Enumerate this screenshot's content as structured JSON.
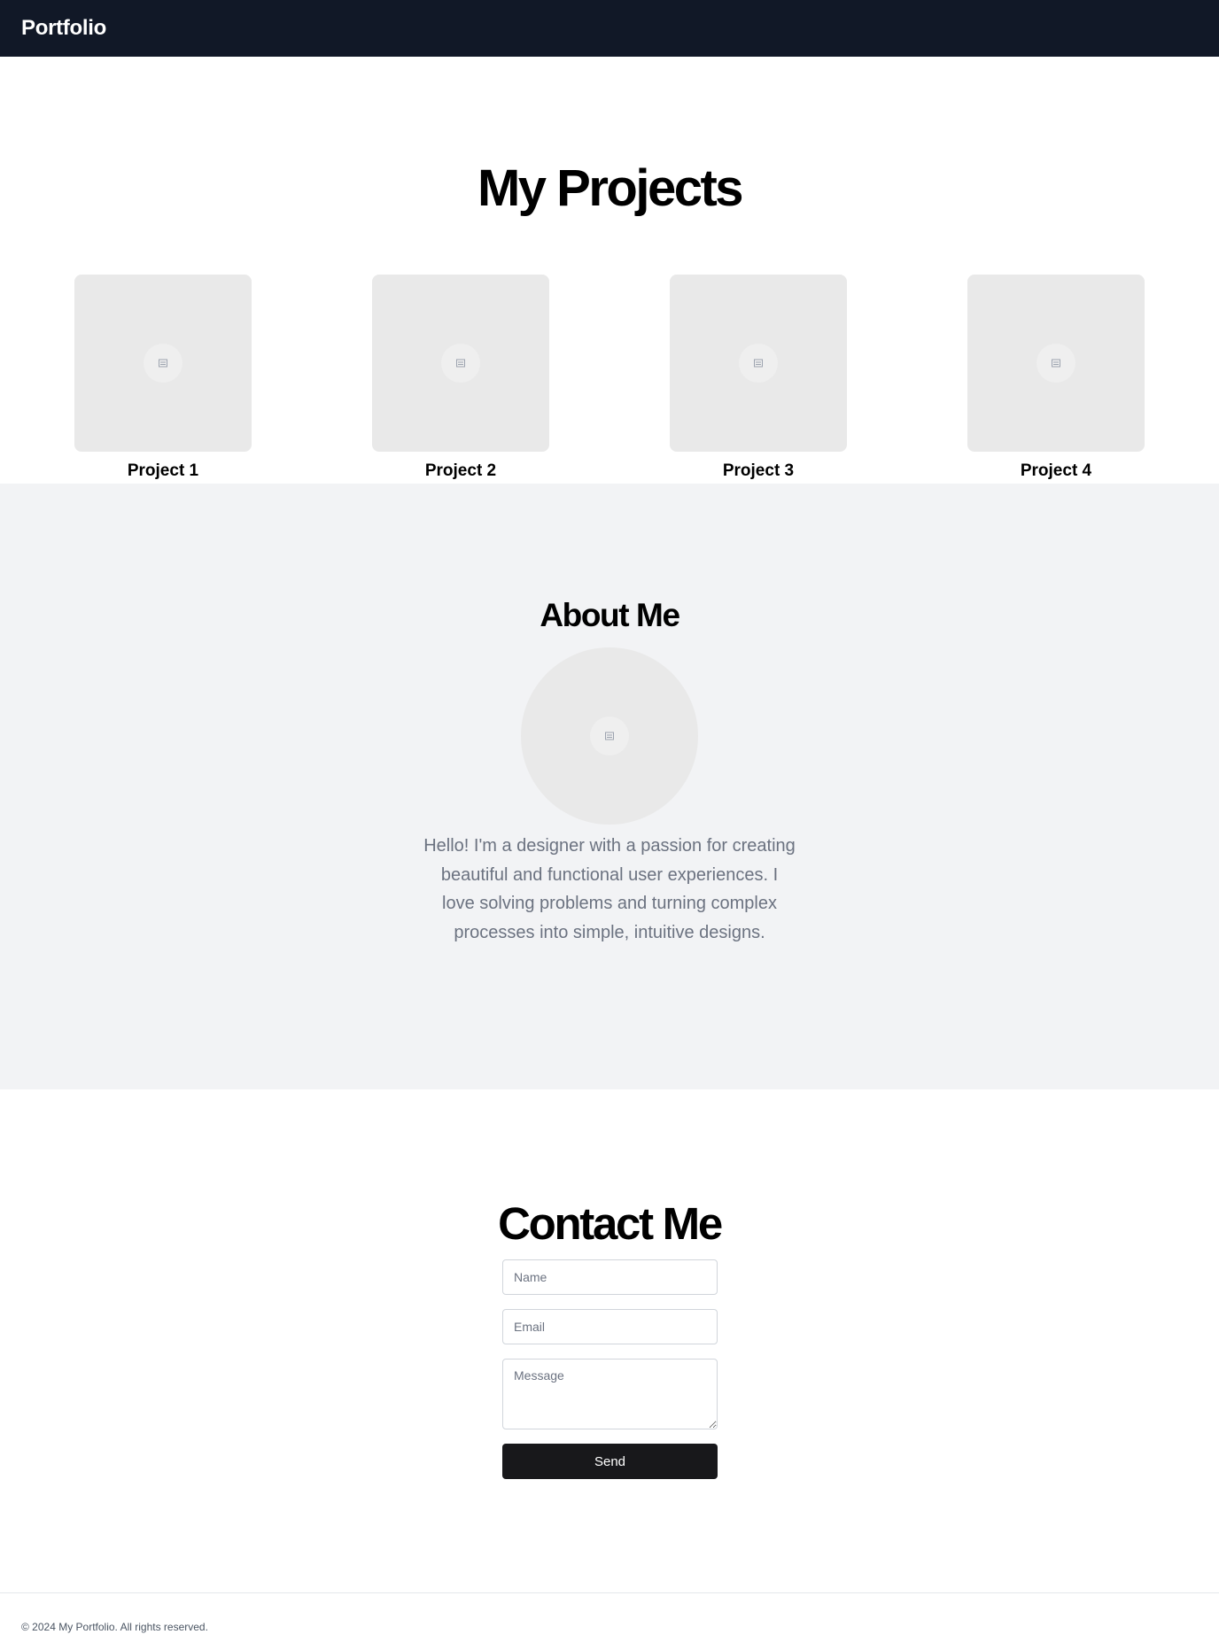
{
  "header": {
    "brand": "Portfolio"
  },
  "projects": {
    "title": "My Projects",
    "items": [
      {
        "title": "Project 1",
        "image_icon": "image-placeholder-icon"
      },
      {
        "title": "Project 2",
        "image_icon": "image-placeholder-icon"
      },
      {
        "title": "Project 3",
        "image_icon": "image-placeholder-icon"
      },
      {
        "title": "Project 4",
        "image_icon": "image-placeholder-icon"
      }
    ]
  },
  "about": {
    "title": "About Me",
    "avatar_icon": "image-placeholder-icon",
    "text": "Hello! I'm a designer with a passion for creating beautiful and functional user experiences. I love solving problems and turning complex processes into simple, intuitive designs."
  },
  "contact": {
    "title": "Contact Me",
    "name_placeholder": "Name",
    "email_placeholder": "Email",
    "message_placeholder": "Message",
    "send_label": "Send"
  },
  "footer": {
    "text": "© 2024 My Portfolio. All rights reserved."
  },
  "colors": {
    "header_bg": "#111827",
    "about_bg": "#f2f3f5",
    "button_bg": "#18181b",
    "placeholder_bg": "#e9e9e9",
    "muted_text": "#6b7280"
  }
}
